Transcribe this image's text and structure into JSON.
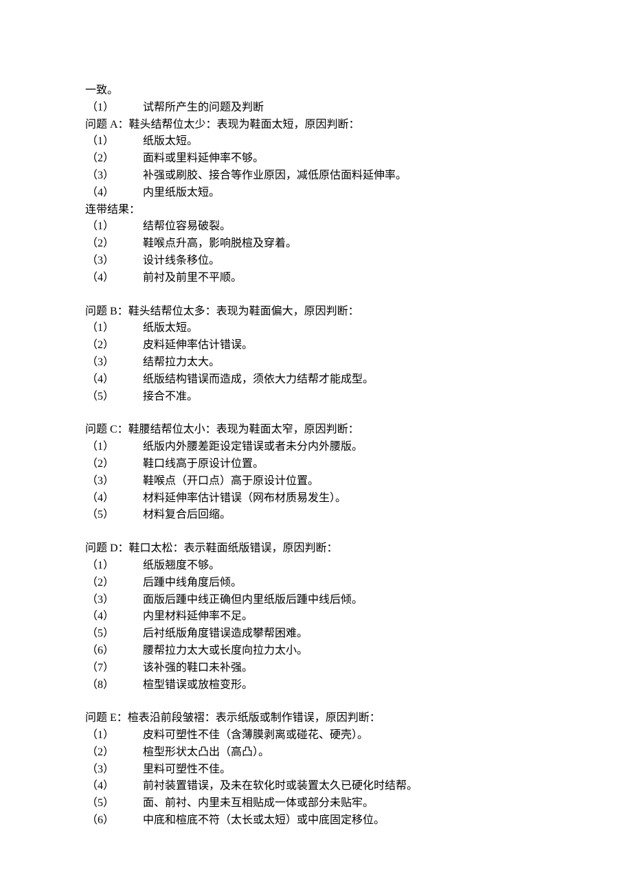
{
  "intro": "一致。",
  "preQuestion": {
    "num": "（1）",
    "text": "试帮所产生的问题及判断"
  },
  "qA": {
    "heading": "问题 A：鞋头结帮位太少：表现为鞋面太短，原因判断：",
    "reasons": [
      {
        "num": "（1）",
        "text": "纸版太短。"
      },
      {
        "num": "（2）",
        "text": "面料或里料延伸率不够。"
      },
      {
        "num": "（3）",
        "text": "补强或刷胶、接合等作业原因，减低原估面料延伸率。"
      },
      {
        "num": "（4）",
        "text": "内里纸版太短。"
      }
    ],
    "resultLabel": "连带结果：",
    "results": [
      {
        "num": "（1）",
        "text": "结帮位容易破裂。"
      },
      {
        "num": "（2）",
        "text": "鞋喉点升高，影响脱楦及穿着。"
      },
      {
        "num": "（3）",
        "text": "设计线条移位。"
      },
      {
        "num": "（4）",
        "text": "前衬及前里不平顺。"
      }
    ]
  },
  "qB": {
    "heading": "问题 B：鞋头结帮位太多：表现为鞋面偏大，原因判断：",
    "items": [
      {
        "num": "（1）",
        "text": "纸版太短。"
      },
      {
        "num": "（2）",
        "text": "皮料延伸率估计错误。"
      },
      {
        "num": "（3）",
        "text": "结帮拉力太大。"
      },
      {
        "num": "（4）",
        "text": "纸版结构错误而造成，须依大力结帮才能成型。"
      },
      {
        "num": "（5）",
        "text": "接合不准。"
      }
    ]
  },
  "qC": {
    "heading": "问题 C：鞋腰结帮位太小：表现为鞋面太窄，原因判断：",
    "items": [
      {
        "num": "（1）",
        "text": "纸版内外腰差距设定错误或者未分内外腰版。"
      },
      {
        "num": "（2）",
        "text": "鞋口线高于原设计位置。"
      },
      {
        "num": "（3）",
        "text": "鞋喉点（开口点）高于原设计位置。"
      },
      {
        "num": "（4）",
        "text": "材料延伸率估计错误（网布材质易发生）。"
      },
      {
        "num": "（5）",
        "text": "材料复合后回缩。"
      }
    ]
  },
  "qD": {
    "heading": "问题 D：鞋口太松：表示鞋面纸版错误，原因判断：",
    "items": [
      {
        "num": "（1）",
        "text": "纸版翘度不够。"
      },
      {
        "num": "（2）",
        "text": "后踵中线角度后倾。"
      },
      {
        "num": "（3）",
        "text": "面版后踵中线正确但内里纸版后踵中线后倾。"
      },
      {
        "num": "（4）",
        "text": "内里材料延伸率不足。"
      },
      {
        "num": "（5）",
        "text": "后衬纸版角度错误造成攀帮困难。"
      },
      {
        "num": "（6）",
        "text": "腰帮拉力太大或长度向拉力太小。"
      },
      {
        "num": "（7）",
        "text": "该补强的鞋口未补强。"
      },
      {
        "num": "（8）",
        "text": "楦型错误或放楦变形。"
      }
    ]
  },
  "qE": {
    "heading": "问题 E：楦表沿前段皱褶：表示纸版或制作错误，原因判断：",
    "items": [
      {
        "num": "（1）",
        "text": "皮料可塑性不佳（含薄膜剥离或碰花、硬壳）。"
      },
      {
        "num": "（2）",
        "text": "楦型形状太凸出（高凸）。"
      },
      {
        "num": "（3）",
        "text": "里料可塑性不佳。"
      },
      {
        "num": "（4）",
        "text": "前衬装置错误，及未在软化时或装置太久已硬化时结帮。"
      },
      {
        "num": "（5）",
        "text": "面、前衬、内里未互相贴成一体或部分未贴牢。"
      },
      {
        "num": "（6）",
        "text": "中底和楦底不符（太长或太短）或中底固定移位。"
      }
    ]
  }
}
